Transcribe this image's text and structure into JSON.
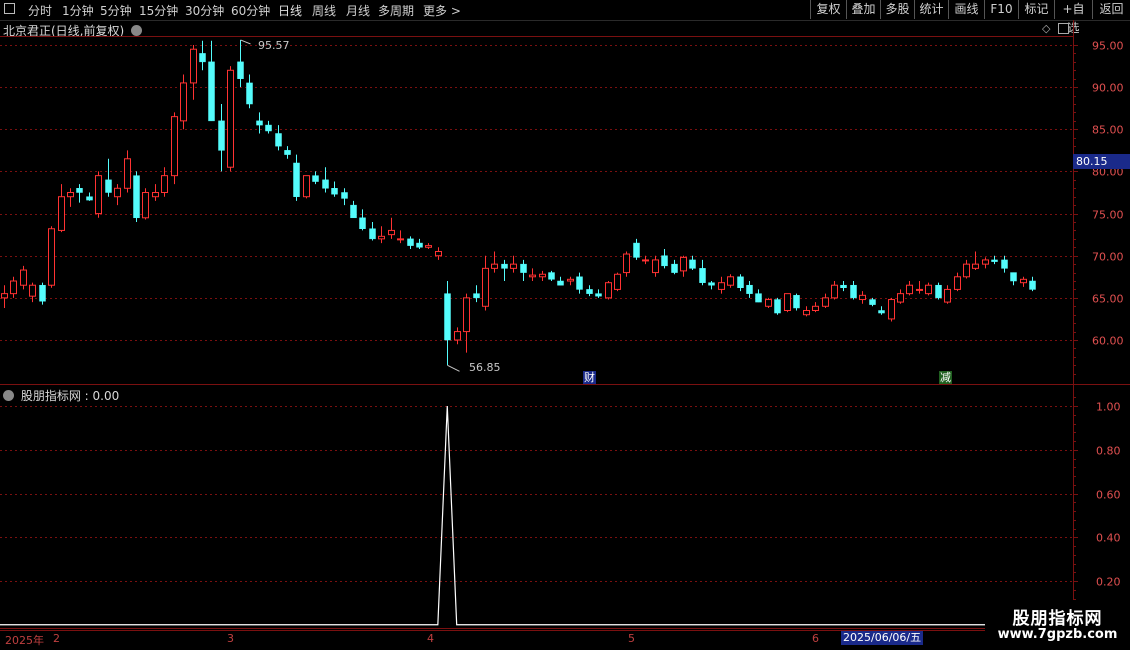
{
  "toolbar": {
    "window_icon": "window-icon",
    "tabs": [
      "分时",
      "1分钟",
      "5分钟",
      "15分钟",
      "30分钟",
      "60分钟",
      "日线",
      "周线",
      "月线",
      "多周期",
      "更多 >"
    ],
    "right_buttons": [
      "复权",
      "叠加",
      "多股",
      "统计",
      "画线",
      "F10",
      "标记",
      "+自选",
      "返回"
    ]
  },
  "main_chart": {
    "title": "北京君正(日线,前复权)",
    "high_label": "95.57",
    "low_label": "56.85",
    "current_price": "80.15",
    "markers": [
      "财",
      "减"
    ],
    "y_ticks": [
      "95.00",
      "90.00",
      "85.00",
      "80.00",
      "75.00",
      "70.00",
      "65.00",
      "60.00"
    ]
  },
  "indicator": {
    "title": "股朋指标网 : 0.00",
    "y_ticks": [
      "1.00",
      "0.80",
      "0.60",
      "0.40",
      "0.20"
    ]
  },
  "date_axis": {
    "labels": [
      "2025年",
      "2",
      "3",
      "4",
      "5",
      "6"
    ],
    "cursor_date": "2025/06/06/五"
  },
  "watermark": {
    "line1": "股朋指标网",
    "line2": "www.7gpzb.com"
  },
  "colors": {
    "up": "#ff3232",
    "down": "#54fcfc",
    "frame": "#7a1010",
    "grid": "#7a1010"
  },
  "chart_data": {
    "type": "candlestick",
    "price_range": [
      55,
      97
    ],
    "candles": [
      [
        65.0,
        66.5,
        63.8,
        65.5
      ],
      [
        65.5,
        67.5,
        65.0,
        67.0
      ],
      [
        66.5,
        68.8,
        66.0,
        68.3
      ],
      [
        65.2,
        66.8,
        64.5,
        66.5
      ],
      [
        66.5,
        66.8,
        64.2,
        64.6
      ],
      [
        66.5,
        73.5,
        66.2,
        73.2
      ],
      [
        73.0,
        78.5,
        72.8,
        77.0
      ],
      [
        77.0,
        78.0,
        75.8,
        77.5
      ],
      [
        78.0,
        78.5,
        76.3,
        77.5
      ],
      [
        77.0,
        77.5,
        76.5,
        76.6
      ],
      [
        75.0,
        80.0,
        74.5,
        79.5
      ],
      [
        79.0,
        81.5,
        77.0,
        77.5
      ],
      [
        77.0,
        78.5,
        76.0,
        78.0
      ],
      [
        78.0,
        82.5,
        77.5,
        81.5
      ],
      [
        79.5,
        80.0,
        74.0,
        74.5
      ],
      [
        74.5,
        78.0,
        74.3,
        77.5
      ],
      [
        77.0,
        78.5,
        76.5,
        77.5
      ],
      [
        77.5,
        80.5,
        77.0,
        79.5
      ],
      [
        79.5,
        87.0,
        78.5,
        86.5
      ],
      [
        86.0,
        91.5,
        85.0,
        90.5
      ],
      [
        90.5,
        95.0,
        88.5,
        94.5
      ],
      [
        94.0,
        95.5,
        92.0,
        93.0
      ],
      [
        93.0,
        95.5,
        86.0,
        86.0
      ],
      [
        86.0,
        88.0,
        80.0,
        82.5
      ],
      [
        80.5,
        92.5,
        80.0,
        92.0
      ],
      [
        93.0,
        95.6,
        90.0,
        91.0
      ],
      [
        90.5,
        91.5,
        87.5,
        88.0
      ],
      [
        86.0,
        87.0,
        84.5,
        85.5
      ],
      [
        85.5,
        86.0,
        84.5,
        84.8
      ],
      [
        84.5,
        85.5,
        82.5,
        83.0
      ],
      [
        82.5,
        83.0,
        81.5,
        82.0
      ],
      [
        81.0,
        82.0,
        76.5,
        77.0
      ],
      [
        77.0,
        79.5,
        76.8,
        79.5
      ],
      [
        79.5,
        80.0,
        78.5,
        78.8
      ],
      [
        79.0,
        80.5,
        77.5,
        78.0
      ],
      [
        78.0,
        78.8,
        77.0,
        77.3
      ],
      [
        77.5,
        78.0,
        76.0,
        76.8
      ],
      [
        76.0,
        76.5,
        74.5,
        74.5
      ],
      [
        74.5,
        75.5,
        73.0,
        73.2
      ],
      [
        73.2,
        74.0,
        71.8,
        72.0
      ],
      [
        72.0,
        73.5,
        71.5,
        72.3
      ],
      [
        72.5,
        74.5,
        72.0,
        73.0
      ],
      [
        72.0,
        73.0,
        71.5,
        72.0
      ],
      [
        72.0,
        72.3,
        70.8,
        71.2
      ],
      [
        71.5,
        72.0,
        70.8,
        71.0
      ],
      [
        71.0,
        71.5,
        70.8,
        71.2
      ],
      [
        70.0,
        71.0,
        69.5,
        70.5
      ],
      [
        65.5,
        67.0,
        57.0,
        60.0
      ],
      [
        60.0,
        61.5,
        59.5,
        61.0
      ],
      [
        61.0,
        65.5,
        58.5,
        65.0
      ],
      [
        65.5,
        66.5,
        64.5,
        65.0
      ],
      [
        64.0,
        70.0,
        63.5,
        68.5
      ],
      [
        68.5,
        70.5,
        68.0,
        69.0
      ],
      [
        69.0,
        69.5,
        67.0,
        68.5
      ],
      [
        68.5,
        70.0,
        68.0,
        69.0
      ],
      [
        69.0,
        69.5,
        67.0,
        68.0
      ],
      [
        67.5,
        68.5,
        67.0,
        67.7
      ],
      [
        67.5,
        68.2,
        67.0,
        67.8
      ],
      [
        68.0,
        68.2,
        67.0,
        67.2
      ],
      [
        67.0,
        67.5,
        66.5,
        66.5
      ],
      [
        67.0,
        67.5,
        66.5,
        67.2
      ],
      [
        67.5,
        68.0,
        65.5,
        66.0
      ],
      [
        66.0,
        66.5,
        65.2,
        65.5
      ],
      [
        65.5,
        66.0,
        65.0,
        65.2
      ],
      [
        65.0,
        67.0,
        64.8,
        66.8
      ],
      [
        66.0,
        68.0,
        65.8,
        67.8
      ],
      [
        68.0,
        70.5,
        67.5,
        70.2
      ],
      [
        71.5,
        72.0,
        69.5,
        69.8
      ],
      [
        69.5,
        70.0,
        69.0,
        69.5
      ],
      [
        68.0,
        70.0,
        67.5,
        69.5
      ],
      [
        70.0,
        70.8,
        68.5,
        68.8
      ],
      [
        69.0,
        69.5,
        67.8,
        68.0
      ],
      [
        68.2,
        70.0,
        67.5,
        69.8
      ],
      [
        69.5,
        70.0,
        68.3,
        68.5
      ],
      [
        68.5,
        69.5,
        66.5,
        66.8
      ],
      [
        66.8,
        67.0,
        66.0,
        66.5
      ],
      [
        66.0,
        67.5,
        65.5,
        66.8
      ],
      [
        66.5,
        67.8,
        66.2,
        67.5
      ],
      [
        67.5,
        67.8,
        65.8,
        66.2
      ],
      [
        66.5,
        67.0,
        65.0,
        65.5
      ],
      [
        65.5,
        66.0,
        64.5,
        64.5
      ],
      [
        64.0,
        65.0,
        63.8,
        64.8
      ],
      [
        64.8,
        65.0,
        63.0,
        63.2
      ],
      [
        63.5,
        65.5,
        63.3,
        65.5
      ],
      [
        65.3,
        65.5,
        63.5,
        63.8
      ],
      [
        63.0,
        64.0,
        62.8,
        63.5
      ],
      [
        63.5,
        64.5,
        63.3,
        64.0
      ],
      [
        64.0,
        65.5,
        63.8,
        65.0
      ],
      [
        65.0,
        67.0,
        64.8,
        66.5
      ],
      [
        66.5,
        67.0,
        65.8,
        66.2
      ],
      [
        66.5,
        67.0,
        64.8,
        65.0
      ],
      [
        64.8,
        65.8,
        64.3,
        65.3
      ],
      [
        64.8,
        65.0,
        64.0,
        64.2
      ],
      [
        63.5,
        64.0,
        63.0,
        63.2
      ],
      [
        62.5,
        65.0,
        62.2,
        64.8
      ],
      [
        64.5,
        66.0,
        64.3,
        65.5
      ],
      [
        65.5,
        67.0,
        65.3,
        66.5
      ],
      [
        66.0,
        67.0,
        65.5,
        66.0
      ],
      [
        65.5,
        66.8,
        65.3,
        66.5
      ],
      [
        66.5,
        66.8,
        64.8,
        65.0
      ],
      [
        64.5,
        66.5,
        64.3,
        66.0
      ],
      [
        66.0,
        68.0,
        65.8,
        67.5
      ],
      [
        67.5,
        69.5,
        67.3,
        69.0
      ],
      [
        68.5,
        70.5,
        68.3,
        69.0
      ],
      [
        69.0,
        69.8,
        68.5,
        69.5
      ],
      [
        69.5,
        70.0,
        69.0,
        69.3
      ],
      [
        69.5,
        70.0,
        68.0,
        68.5
      ],
      [
        68.0,
        68.0,
        66.5,
        67.0
      ],
      [
        66.8,
        67.5,
        66.3,
        67.2
      ],
      [
        67.0,
        67.5,
        65.8,
        66.0
      ]
    ],
    "indicator_series": {
      "name": "股朋指标网",
      "spike_index": 47,
      "spike_value": 1.0,
      "ylim": [
        0,
        1.05
      ]
    }
  }
}
